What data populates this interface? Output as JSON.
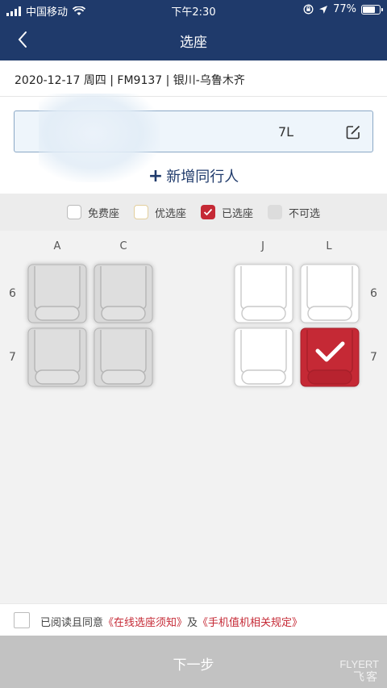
{
  "status_bar": {
    "carrier": "中国移动",
    "time": "下午2:30",
    "battery": "77%"
  },
  "nav": {
    "title": "选座"
  },
  "flight_info": "2020-12-17 周四 | FM9137 | 银川-乌鲁木齐",
  "passenger": {
    "seat": "7L"
  },
  "add_companion": "新增同行人",
  "legend": [
    {
      "label": "免费座",
      "kind": "free"
    },
    {
      "label": "优选座",
      "kind": "premium"
    },
    {
      "label": "已选座",
      "kind": "selected"
    },
    {
      "label": "不可选",
      "kind": "unavailable"
    }
  ],
  "seat_map": {
    "columns": [
      "A",
      "C",
      "J",
      "L"
    ],
    "rows": [
      {
        "number": "6",
        "seats": [
          "unavailable",
          "unavailable",
          "available",
          "available"
        ]
      },
      {
        "number": "7",
        "seats": [
          "unavailable",
          "unavailable",
          "available",
          "selected"
        ]
      }
    ]
  },
  "agreement": {
    "prefix": "已阅读且同意",
    "link1": "《在线选座须知》",
    "and": "及",
    "link2": "《手机值机相关规定》"
  },
  "next_button": "下一步",
  "watermark": {
    "en": "FLYERT",
    "cn": "飞客"
  },
  "colors": {
    "nav": "#1f3a6b",
    "selected": "#c52935",
    "unavailable": "#dcdcdc"
  }
}
